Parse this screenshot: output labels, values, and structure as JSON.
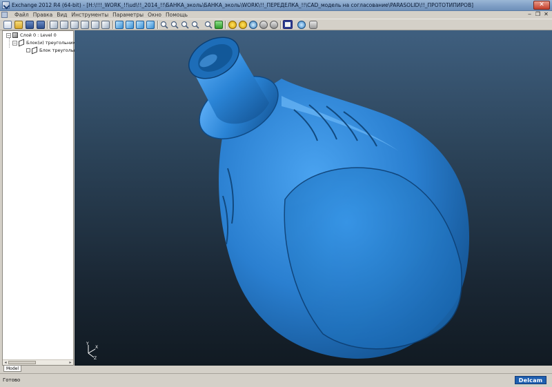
{
  "window": {
    "title": "Exchange 2012 R4 (64-bit) - [H:\\!!!_WORK_!!\\ud\\!!_2014_!!\\БАНКА_эколь\\БАНКА_эколь\\WORK\\!!_ПЕРЕДЕЛКА_!!\\CAD_модель на согласование\\PARASOLID\\!!_ПРОТОТИПИРОВ]",
    "close_glyph": "✕"
  },
  "menu": {
    "items": [
      "Файл",
      "Правка",
      "Вид",
      "Инструменты",
      "Параметры",
      "Окно",
      "Помощь"
    ]
  },
  "toolbar": {
    "icons": [
      "new-document-icon",
      "open-folder-icon",
      "save-icon",
      "save-as-icon",
      "view-front-icon",
      "view-back-icon",
      "view-left-icon",
      "view-right-icon",
      "view-top-icon",
      "view-bottom-icon",
      "iso-view-1-icon",
      "iso-view-2-icon",
      "iso-view-3-icon",
      "iso-view-4-icon",
      "zoom-in-icon",
      "zoom-window-icon",
      "zoom-out-icon",
      "zoom-all-icon",
      "zoom-selection-icon",
      "refresh-icon",
      "rotate-icon",
      "shading-icon",
      "wireframe-icon",
      "globe-icon",
      "settings-icon",
      "active-display-icon",
      "help-icon",
      "users-icon"
    ]
  },
  "tree": {
    "items": [
      {
        "label": "Слой 0 : Level 0"
      },
      {
        "label": "Блок(и) треугольников"
      },
      {
        "label": "Блок треугольник"
      }
    ]
  },
  "model": {
    "color_main": "#2a7fd0",
    "color_dark": "#11497f",
    "color_light": "#7cc4ff"
  },
  "axes": {
    "labels": [
      "Y",
      "X",
      "Z"
    ]
  },
  "tabs": {
    "model_tab": "Model"
  },
  "status": {
    "text": "Готово",
    "brand": "Delcam"
  }
}
